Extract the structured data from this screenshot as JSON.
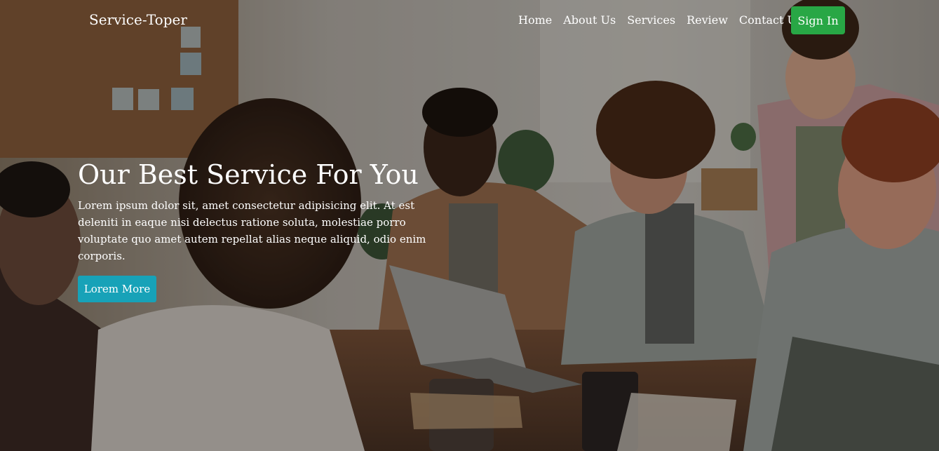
{
  "navbar": {
    "brand": "Service-Toper",
    "links": [
      {
        "label": "Home"
      },
      {
        "label": "About Us"
      },
      {
        "label": "Services"
      },
      {
        "label": "Review"
      },
      {
        "label": "Contact Us"
      }
    ],
    "signin_label": "Sign In"
  },
  "hero": {
    "title": "Our Best Service For You",
    "text": "Lorem ipsum dolor sit, amet consectetur adipisicing elit. At est deleniti in eaque nisi delectus ratione soluta, molestiae porro voluptate quo amet autem repellat alias neque aliquid, odio enim corporis.",
    "cta_label": "Lorem More"
  },
  "colors": {
    "signin_bg": "#28a745",
    "cta_bg": "#17a2b8",
    "overlay": "rgba(0,0,0,0.30)"
  }
}
